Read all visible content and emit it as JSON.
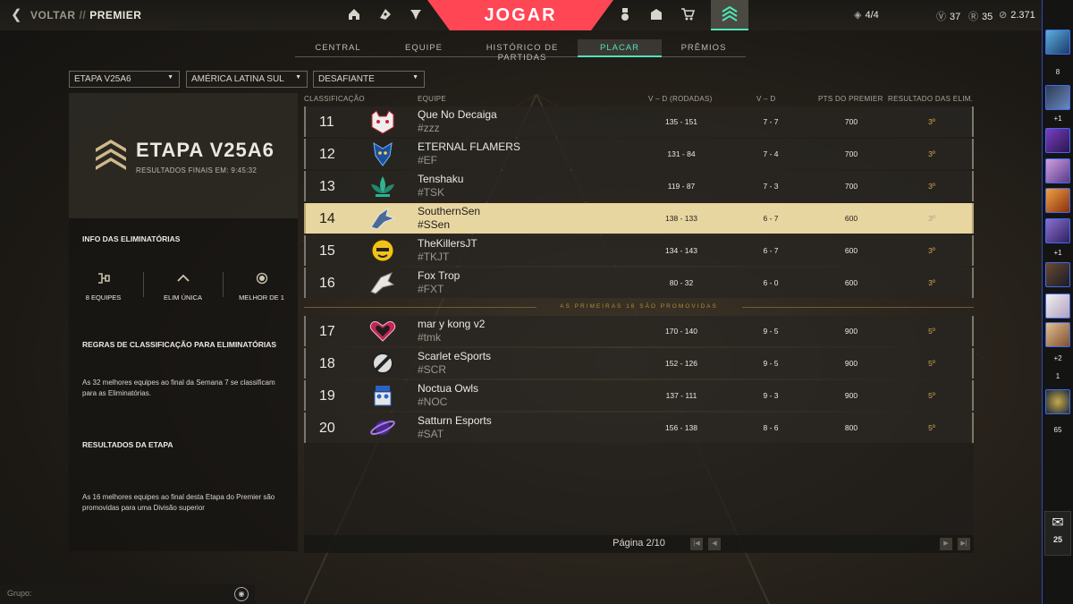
{
  "topbar": {
    "back_label": "VOLTAR",
    "separator": "//",
    "section": "PREMIER",
    "play_label": "JOGAR",
    "party_count": "4/4",
    "currency_1": "37",
    "currency_2": "35",
    "currency_3": "2.371"
  },
  "tabs": [
    {
      "label": "CENTRAL",
      "active": false
    },
    {
      "label": "EQUIPE",
      "active": false
    },
    {
      "label": "HISTÓRICO DE PARTIDAS",
      "active": false
    },
    {
      "label": "PLACAR",
      "active": true
    },
    {
      "label": "PRÊMIOS",
      "active": false
    }
  ],
  "filters": {
    "stage": "ETAPA V25A6",
    "region": "AMÉRICA LATINA SUL",
    "division": "DESAFIANTE"
  },
  "left_panel": {
    "stage_title": "ETAPA V25A6",
    "final_results": "RESULTADOS FINAIS EM: 9:45:32",
    "playoffs_info_title": "INFO DAS ELIMINATÓRIAS",
    "stat_teams": "8 EQUIPES",
    "stat_format": "ELIM ÚNICA",
    "stat_series": "MELHOR DE 1",
    "rules_title": "REGRAS DE CLASSIFICAÇÃO PARA ELIMINATÓRIAS",
    "rules_text": "As 32 melhores equipes ao final da Semana 7 se classificam para as Eliminatórias.",
    "results_title": "RESULTADOS DA ETAPA",
    "results_text": "As 16 melhores equipes ao final desta Etapa do Premier são promovidas para uma Divisão superior"
  },
  "table": {
    "headers": {
      "rank": "CLASSIFICAÇÃO",
      "team": "EQUIPE",
      "rounds": "V – D (RODADAS)",
      "wl": "V – D",
      "points": "PTS DO PREMIER",
      "playoffs": "RESULTADO DAS ELIM."
    },
    "rows": [
      {
        "rank": "11",
        "name": "Que No Decaiga",
        "tag": "#zzz",
        "rounds": "135 - 151",
        "wl": "7 - 7",
        "points": "700",
        "result": "3º",
        "highlight": false
      },
      {
        "rank": "12",
        "name": "ETERNAL FLAMERS",
        "tag": "#EF",
        "rounds": "131 - 84",
        "wl": "7 - 4",
        "points": "700",
        "result": "3º",
        "highlight": false
      },
      {
        "rank": "13",
        "name": "Tenshaku",
        "tag": "#TSK",
        "rounds": "119 - 87",
        "wl": "7 - 3",
        "points": "700",
        "result": "3º",
        "highlight": false
      },
      {
        "rank": "14",
        "name": "SouthernSen",
        "tag": "#SSen",
        "rounds": "138 - 133",
        "wl": "6 - 7",
        "points": "600",
        "result": "3º",
        "highlight": true
      },
      {
        "rank": "15",
        "name": "TheKillersJT",
        "tag": "#TKJT",
        "rounds": "134 - 143",
        "wl": "6 - 7",
        "points": "600",
        "result": "3º",
        "highlight": false
      },
      {
        "rank": "16",
        "name": "Fox Trop",
        "tag": "#FXT",
        "rounds": "80 - 32",
        "wl": "6 - 0",
        "points": "600",
        "result": "3º",
        "highlight": false
      },
      {
        "rank": "17",
        "name": "mar y kong v2",
        "tag": "#tmk",
        "rounds": "170 - 140",
        "wl": "9 - 5",
        "points": "900",
        "result": "5º",
        "highlight": false
      },
      {
        "rank": "18",
        "name": "Scarlet eSports",
        "tag": "#SCR",
        "rounds": "152 - 126",
        "wl": "9 - 5",
        "points": "900",
        "result": "5º",
        "highlight": false
      },
      {
        "rank": "19",
        "name": "Noctua Owls",
        "tag": "#NOC",
        "rounds": "137 - 111",
        "wl": "9 - 3",
        "points": "900",
        "result": "5º",
        "highlight": false
      },
      {
        "rank": "20",
        "name": "Satturn Esports",
        "tag": "#SAT",
        "rounds": "156 - 138",
        "wl": "8 - 6",
        "points": "800",
        "result": "5º",
        "highlight": false
      }
    ],
    "promotion_note": "AS PRIMEIRAS 16 SÃO PROMOVIDAS"
  },
  "pagination": {
    "label": "Página 2/10"
  },
  "footer": {
    "group_label": "Grupo:"
  },
  "social": {
    "count_1": "8",
    "count_2": "+1",
    "count_3": "+1",
    "count_4": "+2",
    "count_5": "1",
    "count_6": "65",
    "mail_count": "25"
  },
  "colors": {
    "accent_teal": "#4ee6b8",
    "play_red": "#ff4655",
    "highlight_row": "#e8d6a1",
    "result_gold": "#d4a74a"
  }
}
